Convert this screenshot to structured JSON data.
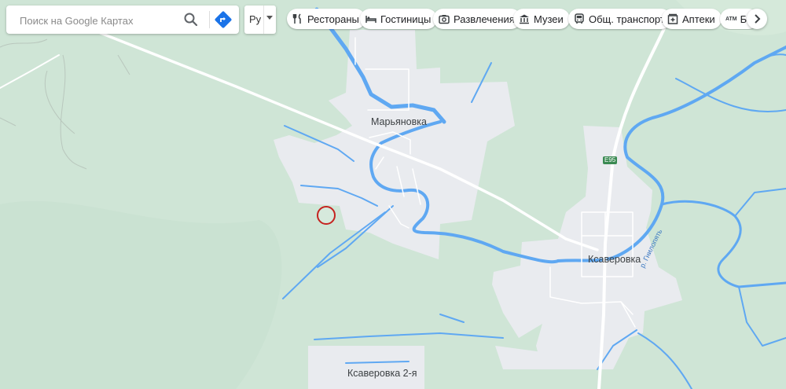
{
  "search": {
    "placeholder": "Поиск на Google Картах"
  },
  "icons": {
    "search": "search-icon",
    "directions": "directions-icon",
    "more": "chevron-right-icon"
  },
  "layer_select": {
    "value": "Ру"
  },
  "chips": [
    {
      "label": "Рестораны",
      "icon": "restaurant-icon"
    },
    {
      "label": "Гостиницы",
      "icon": "hotel-icon"
    },
    {
      "label": "Развлечения",
      "icon": "camera-icon"
    },
    {
      "label": "Музеи",
      "icon": "museum-icon"
    },
    {
      "label": "Общ. транспорт",
      "icon": "transit-icon"
    },
    {
      "label": "Аптеки",
      "icon": "pharmacy-icon"
    },
    {
      "label": "Ба",
      "icon": "atm-icon"
    }
  ],
  "map": {
    "places": {
      "maryanovka": "Марьяновка",
      "ksaverovka": "Ксаверовка",
      "ksaverovka2": "Ксаверовка 2-я"
    },
    "road_shield": "E95",
    "river_label": "р. Гнилопять",
    "atm_text": "ATM",
    "colors": {
      "forest": "#cfe5d6",
      "settlement": "#e9ebef",
      "water": "#5fa8f2",
      "road": "#ffffff",
      "marker": "#c5221f"
    }
  }
}
